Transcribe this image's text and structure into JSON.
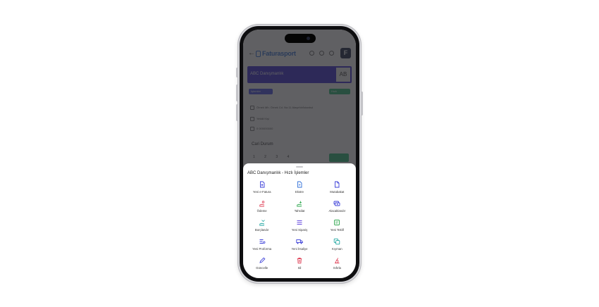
{
  "header": {
    "app_name": "Faturasport",
    "badge_letter": "F"
  },
  "company": {
    "name": "ABC Danışmanlık",
    "initials": "AB"
  },
  "pills": {
    "left": "İşlemler",
    "right": "Hızlı"
  },
  "info": {
    "address": "Örnek Mh. Örnek Cd. No:11 Ataşehir/İstanbul",
    "person": "Yetkili Kişi",
    "phone": "0 000000000"
  },
  "section": {
    "title": "Cari Durum",
    "tabs": [
      "1",
      "2",
      "3",
      "4"
    ]
  },
  "sheet": {
    "title": "ABC Danışmanlık - Hızlı İşlemler",
    "actions": [
      {
        "label": "Yeni e-Fatura",
        "icon": "file-plus-icon",
        "color": "#3b3fd8"
      },
      {
        "label": "Ekstre",
        "icon": "file-list-icon",
        "color": "#2f6fd8"
      },
      {
        "label": "Mutabakat",
        "icon": "document-icon",
        "color": "#3b3fd8"
      },
      {
        "label": "Ödeme",
        "icon": "hand-payment-icon",
        "color": "#e0445a"
      },
      {
        "label": "Tahsilat",
        "icon": "hand-collect-icon",
        "color": "#2fa84f"
      },
      {
        "label": "Alacaklandır",
        "icon": "money-stack-icon",
        "color": "#3b3fd8"
      },
      {
        "label": "Borçlandır",
        "icon": "hand-debt-icon",
        "color": "#1fa6a0"
      },
      {
        "label": "Yeni Sipariş",
        "icon": "order-list-icon",
        "color": "#6a4de0"
      },
      {
        "label": "Yeni Teklif",
        "icon": "quote-card-icon",
        "color": "#2fa84f"
      },
      {
        "label": "Yeni Proforma",
        "icon": "proforma-list-icon",
        "color": "#3b3fd8"
      },
      {
        "label": "Yeni İrsaliye",
        "icon": "truck-icon",
        "color": "#3b3fd8"
      },
      {
        "label": "Kıyman",
        "icon": "copy-icon",
        "color": "#1fa6a0"
      },
      {
        "label": "Güncelle",
        "icon": "pencil-icon",
        "color": "#3b3fd8"
      },
      {
        "label": "Sil",
        "icon": "trash-icon",
        "color": "#e0445a"
      },
      {
        "label": "Sıfırla",
        "icon": "reset-icon",
        "color": "#e0445a"
      }
    ]
  }
}
